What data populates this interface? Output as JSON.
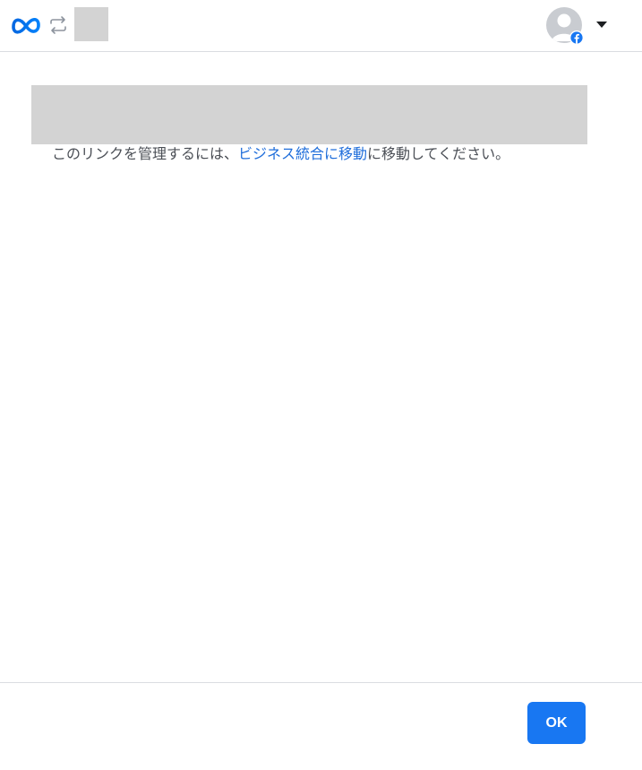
{
  "header": {
    "logo_icon": "meta-logo-icon",
    "swap_icon": "swap-arrows-icon",
    "avatar_icon": "default-avatar-icon",
    "badge_icon": "facebook-badge-icon",
    "menu_icon": "caret-down-icon"
  },
  "main": {
    "message_prefix": "このリンクを管理するには、",
    "link_text": "ビジネス統合に移動",
    "message_suffix": "に移動してください。"
  },
  "footer": {
    "ok_label": "OK"
  },
  "colors": {
    "brand_blue": "#1877f2",
    "link_blue": "#216fdb",
    "text_gray": "#4b4f56",
    "divider": "#dadde1",
    "placeholder_gray": "#d3d3d3"
  }
}
